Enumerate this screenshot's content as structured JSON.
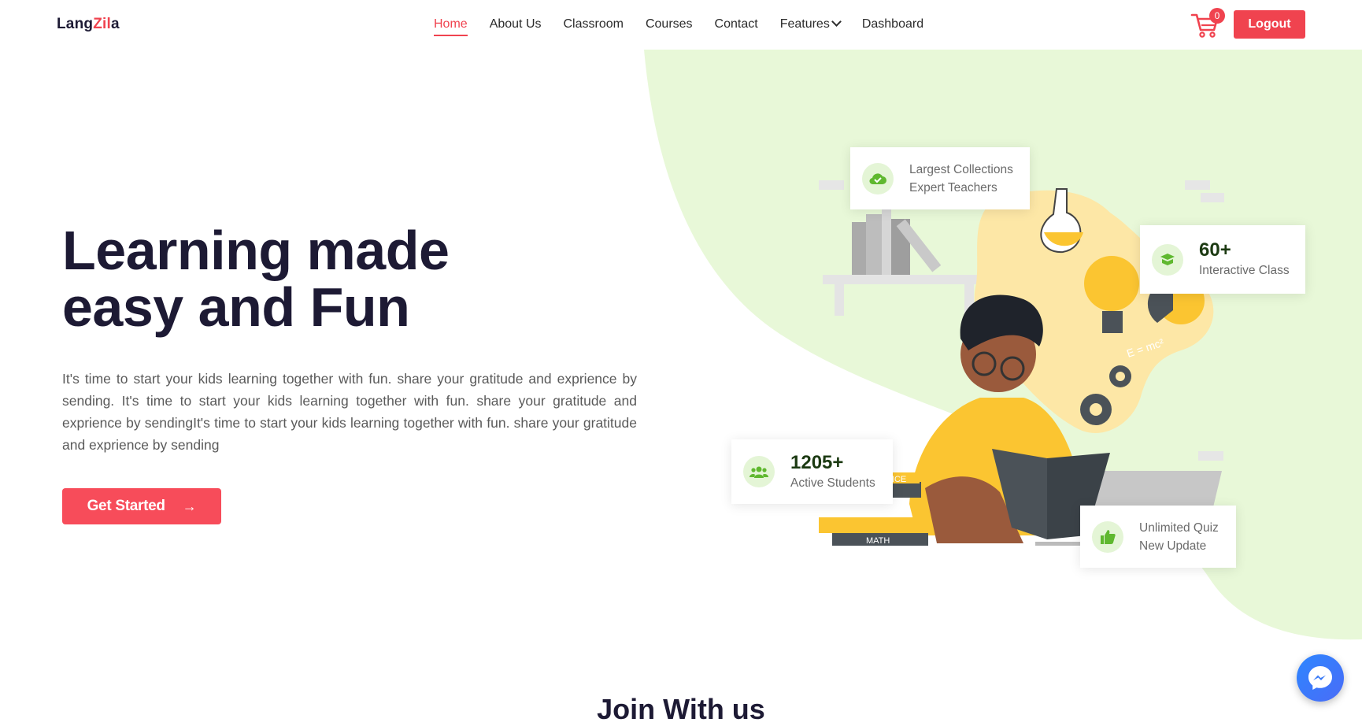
{
  "brand": {
    "part1": "Lang",
    "part2": "Zil",
    "part3": "a"
  },
  "nav": {
    "items": [
      {
        "label": "Home",
        "active": true
      },
      {
        "label": "About Us"
      },
      {
        "label": "Classroom"
      },
      {
        "label": "Courses"
      },
      {
        "label": "Contact"
      },
      {
        "label": "Features"
      },
      {
        "label": "Dashboard"
      }
    ]
  },
  "cart": {
    "count": "0",
    "icon": "cart-icon"
  },
  "header": {
    "logout_label": "Logout"
  },
  "hero": {
    "title_line1": "Learning made",
    "title_line2": "easy and Fun",
    "body": "It's time to start your kids learning together with fun. share your gratitude and exprience by sending. It's time to start your kids learning together with fun. share your gratitude and exprience by sendingIt's time to start your kids learning together with fun. share your gratitude and exprience by sending",
    "cta_label": "Get Started"
  },
  "stats": {
    "collections": {
      "line1": "Largest Collections",
      "line2": "Expert Teachers",
      "icon": "cloud-check-icon"
    },
    "classes": {
      "value": "60+",
      "label": "Interactive Class",
      "icon": "book-icon"
    },
    "students": {
      "value": "1205+",
      "label": "Active Students",
      "icon": "users-icon"
    },
    "quiz": {
      "line1": "Unlimited Quiz",
      "line2": "New Update",
      "icon": "thumbs-up-icon"
    }
  },
  "illustration": {
    "book_label_math": "MATH",
    "book_label_science": "NCE",
    "formula": "E = mc²"
  },
  "section": {
    "title": "Join With us"
  },
  "colors": {
    "accent": "#f0434f",
    "blob": "#e8f8d8",
    "yellow": "#fbc531",
    "iconGreen": "#5fb82f"
  }
}
